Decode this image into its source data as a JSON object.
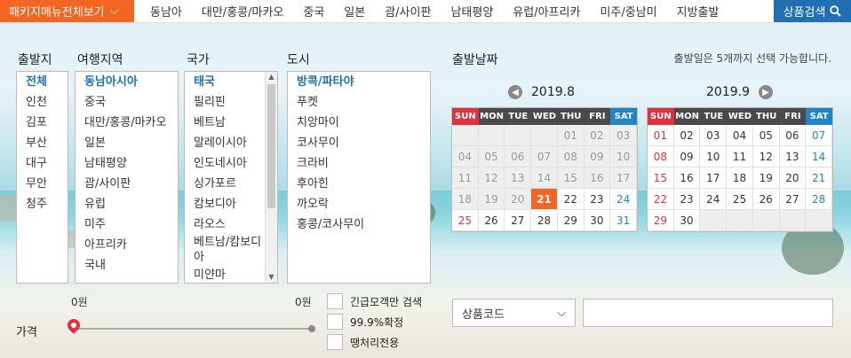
{
  "topbar": {
    "menu_label": "패키지메뉴전체보기",
    "nav": [
      "동남아",
      "대만/홍콩/마카오",
      "중국",
      "일본",
      "괌/사이판",
      "남태평양",
      "유럽/아프리카",
      "미주/중남미",
      "지방출발"
    ],
    "search_label": "상품검색"
  },
  "filters": {
    "departure": {
      "title": "출발지",
      "items": [
        "전체",
        "인천",
        "김포",
        "부산",
        "대구",
        "무안",
        "청주"
      ]
    },
    "region": {
      "title": "여행지역",
      "items": [
        "동남아시아",
        "중국",
        "대만/홍콩/마카오",
        "일본",
        "남태평양",
        "괌/사이판",
        "유럽",
        "미주",
        "아프리카",
        "국내"
      ]
    },
    "country": {
      "title": "국가",
      "items": [
        "태국",
        "필리핀",
        "베트남",
        "말레이시아",
        "인도네시아",
        "싱가포르",
        "캄보디아",
        "라오스",
        "베트남/캄보디",
        "아",
        "미얀마"
      ]
    },
    "city": {
      "title": "도시",
      "items": [
        "방콕/파타야",
        "푸켓",
        "치앙마이",
        "코사무이",
        "크라비",
        "후아힌",
        "까오락",
        "홍콩/코사무이"
      ]
    }
  },
  "calendar": {
    "title": "출발날짜",
    "note": "출발일은 5개까지 선택 가능합니다.",
    "weekdays": [
      "SUN",
      "MON",
      "TUE",
      "WED",
      "THU",
      "FRI",
      "SAT"
    ],
    "months": [
      {
        "label": "2019.8",
        "prev_icon": "chevron-left-icon",
        "cells": [
          "",
          "",
          "",
          "",
          "01",
          "02",
          "03",
          "04",
          "05",
          "06",
          "07",
          "08",
          "09",
          "10",
          "11",
          "12",
          "13",
          "14",
          "15",
          "16",
          "17",
          "18",
          "19",
          "20",
          "21",
          "22",
          "23",
          "24",
          "25",
          "26",
          "27",
          "28",
          "29",
          "30",
          "31"
        ],
        "today": "21"
      },
      {
        "label": "2019.9",
        "next_icon": "chevron-right-icon",
        "cells": [
          "01",
          "02",
          "03",
          "04",
          "05",
          "06",
          "07",
          "08",
          "09",
          "10",
          "11",
          "12",
          "13",
          "14",
          "15",
          "16",
          "17",
          "18",
          "19",
          "20",
          "21",
          "22",
          "23",
          "24",
          "25",
          "26",
          "27",
          "28",
          "29",
          "30"
        ]
      }
    ]
  },
  "price": {
    "label": "가격",
    "min": "0원",
    "max": "0원"
  },
  "options": [
    "긴급모객만 검색",
    "99.9%확정",
    "땡처리전용"
  ],
  "product_code": {
    "selected": "상품코드"
  },
  "colors": {
    "accent": "#f26522",
    "primary": "#1f6fb2",
    "sunday": "#e0323c",
    "saturday": "#1f86c8"
  }
}
